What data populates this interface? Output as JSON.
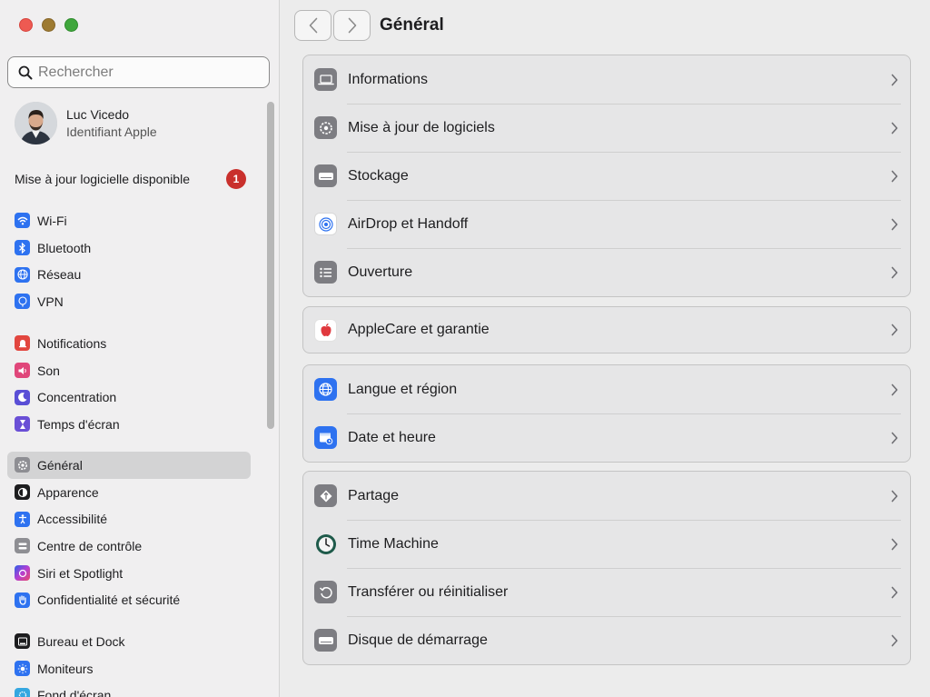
{
  "sidebar": {
    "search_placeholder": "Rechercher",
    "profile": {
      "name": "Luc Vicedo",
      "subtitle": "Identifiant Apple"
    },
    "update": {
      "label": "Mise à jour logicielle disponible",
      "badge": "1"
    },
    "groups": [
      [
        {
          "label": "Wi-Fi",
          "icon": "wifi-icon",
          "color": "#2e72f0"
        },
        {
          "label": "Bluetooth",
          "icon": "bluetooth-icon",
          "color": "#2e72f0"
        },
        {
          "label": "Réseau",
          "icon": "globe-icon",
          "color": "#2e72f0"
        },
        {
          "label": "VPN",
          "icon": "vpn-icon",
          "color": "#2e72f0"
        }
      ],
      [
        {
          "label": "Notifications",
          "icon": "notifications-icon",
          "color": "#e2463f"
        },
        {
          "label": "Son",
          "icon": "speaker-icon",
          "color": "#e0467a"
        },
        {
          "label": "Concentration",
          "icon": "moon-icon",
          "color": "#5a4fd6"
        },
        {
          "label": "Temps d'écran",
          "icon": "hourglass-icon",
          "color": "#6a4fd6"
        }
      ],
      [
        {
          "label": "Général",
          "icon": "gear-icon",
          "color": "#8e8e93",
          "selected": true
        },
        {
          "label": "Apparence",
          "icon": "appearance-icon",
          "color": "#1d1d1f"
        },
        {
          "label": "Accessibilité",
          "icon": "accessibility-icon",
          "color": "#2e72f0"
        },
        {
          "label": "Centre de contrôle",
          "icon": "control-center-icon",
          "color": "#8e8e93"
        },
        {
          "label": "Siri et Spotlight",
          "icon": "siri-icon",
          "color": "#8b3fd1"
        },
        {
          "label": "Confidentialité et sécurité",
          "icon": "hand-icon",
          "color": "#2e72f0"
        }
      ],
      [
        {
          "label": "Bureau et Dock",
          "icon": "dock-icon",
          "color": "#1d1d1f"
        },
        {
          "label": "Moniteurs",
          "icon": "sun-icon",
          "color": "#2e72f0"
        },
        {
          "label": "Fond d'écran",
          "icon": "wallpaper-icon",
          "color": "#35a7e0"
        }
      ]
    ]
  },
  "main": {
    "title": "Général",
    "cards": [
      [
        {
          "label": "Informations",
          "icon": "laptop-icon"
        },
        {
          "label": "Mise à jour de logiciels",
          "icon": "software-update-icon"
        },
        {
          "label": "Stockage",
          "icon": "storage-icon"
        },
        {
          "label": "AirDrop et Handoff",
          "icon": "airdrop-icon"
        },
        {
          "label": "Ouverture",
          "icon": "login-items-icon"
        }
      ],
      [
        {
          "label": "AppleCare et garantie",
          "icon": "apple-icon"
        }
      ],
      [
        {
          "label": "Langue et région",
          "icon": "globe-icon"
        },
        {
          "label": "Date et heure",
          "icon": "calendar-clock-icon"
        }
      ],
      [
        {
          "label": "Partage",
          "icon": "sharing-icon"
        },
        {
          "label": "Time Machine",
          "icon": "time-machine-icon"
        },
        {
          "label": "Transférer ou réinitialiser",
          "icon": "reset-icon"
        },
        {
          "label": "Disque de démarrage",
          "icon": "startup-disk-icon"
        }
      ]
    ]
  }
}
